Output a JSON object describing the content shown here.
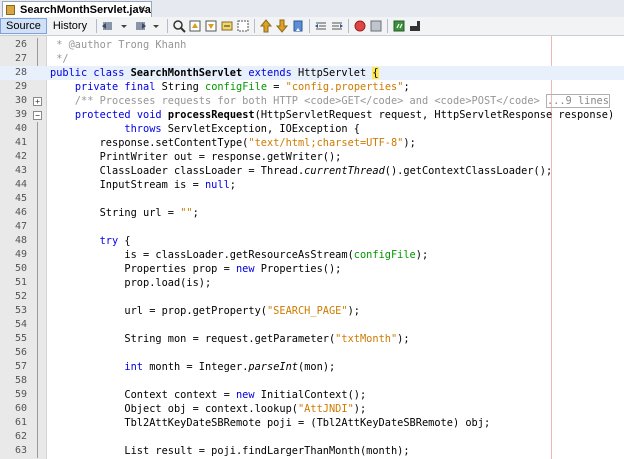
{
  "tab": {
    "title": "SearchMonthServlet.java",
    "close_glyph": "×"
  },
  "toolbar": {
    "source_label": "Source",
    "history_label": "History",
    "icons": [
      "history-back-icon",
      "history-forward-icon",
      "find-icon",
      "find-prev-icon",
      "find-next-icon",
      "toggle-highlight-icon",
      "toggle-rect-select-icon",
      "prev-bookmark-icon",
      "next-bookmark-icon",
      "toggle-bookmark-icon",
      "shift-left-icon",
      "shift-right-icon",
      "start-macro-icon",
      "stop-macro-icon",
      "comment-icon",
      "uncomment-icon"
    ]
  },
  "lines": [
    {
      "num": "26",
      "text": " * @author Trong Khanh"
    },
    {
      "num": "27",
      "text": " */"
    },
    {
      "num": "28",
      "text": "public class SearchMonthServlet extends HttpServlet {"
    },
    {
      "num": "29",
      "text": "    private final String configFile = \"config.properties\";"
    },
    {
      "num": "30",
      "text": "    /** Processes requests for both HTTP <code>GET</code> and <code>POST</code> ...9 lines"
    },
    {
      "num": "39",
      "text": "    protected void processRequest(HttpServletRequest request, HttpServletResponse response)"
    },
    {
      "num": "40",
      "text": "            throws ServletException, IOException {"
    },
    {
      "num": "41",
      "text": "        response.setContentType(\"text/html;charset=UTF-8\");"
    },
    {
      "num": "42",
      "text": "        PrintWriter out = response.getWriter();"
    },
    {
      "num": "43",
      "text": "        ClassLoader classLoader = Thread.currentThread().getContextClassLoader();"
    },
    {
      "num": "44",
      "text": "        InputStream is = null;"
    },
    {
      "num": "45",
      "text": ""
    },
    {
      "num": "46",
      "text": "        String url = \"\";"
    },
    {
      "num": "47",
      "text": ""
    },
    {
      "num": "48",
      "text": "        try {"
    },
    {
      "num": "49",
      "text": "            is = classLoader.getResourceAsStream(configFile);"
    },
    {
      "num": "50",
      "text": "            Properties prop = new Properties();"
    },
    {
      "num": "51",
      "text": "            prop.load(is);"
    },
    {
      "num": "52",
      "text": ""
    },
    {
      "num": "53",
      "text": "            url = prop.getProperty(\"SEARCH_PAGE\");"
    },
    {
      "num": "54",
      "text": ""
    },
    {
      "num": "55",
      "text": "            String mon = request.getParameter(\"txtMonth\");"
    },
    {
      "num": "56",
      "text": ""
    },
    {
      "num": "57",
      "text": "            int month = Integer.parseInt(mon);"
    },
    {
      "num": "58",
      "text": ""
    },
    {
      "num": "59",
      "text": "            Context context = new InitialContext();"
    },
    {
      "num": "60",
      "text": "            Object obj = context.lookup(\"AttJNDI\");"
    },
    {
      "num": "61",
      "text": "            Tbl2AttKeyDateSBRemote poji = (Tbl2AttKeyDateSBRemote) obj;"
    },
    {
      "num": "62",
      "text": ""
    },
    {
      "num": "63",
      "text": "            List result = poji.findLargerThanMonth(month);"
    }
  ],
  "fold_markers": {
    "30": "+",
    "39": "−"
  },
  "colors": {
    "keyword": "#0000e6",
    "string": "#ce7b00",
    "field": "#009900",
    "comment": "#969696",
    "caret_line": "#e8f0fb",
    "brace_match": "#ffe94f",
    "margin_line": "#f0b7b7"
  }
}
